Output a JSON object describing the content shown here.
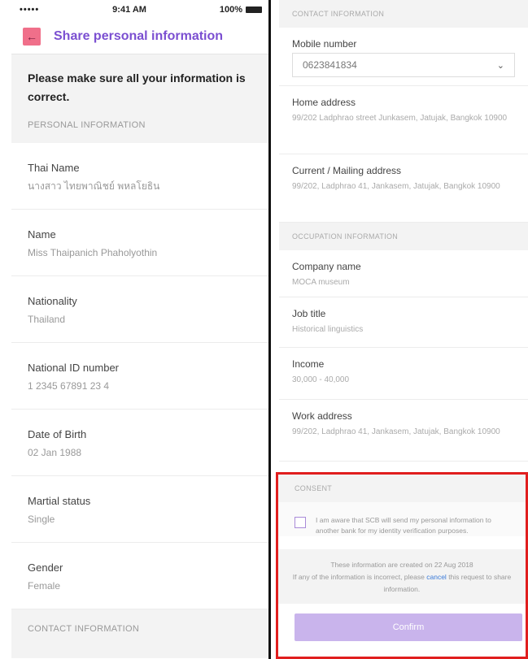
{
  "status_bar": {
    "signal": "•••••",
    "time": "9:41 AM",
    "battery": "100%"
  },
  "header": {
    "title": "Share personal information",
    "back_icon": "arrow-left-icon"
  },
  "notice": "Please make sure all your information is correct.",
  "personal_section": {
    "heading": "PERSONAL INFORMATION",
    "fields": [
      {
        "label": "Thai Name",
        "value": "นางสาว ไทยพาณิชย์ พหลโยธิน"
      },
      {
        "label": "Name",
        "value": "Miss Thaipanich Phaholyothin"
      },
      {
        "label": "Nationality",
        "value": "Thailand"
      },
      {
        "label": "National ID number",
        "value": "1 2345 67891 23 4"
      },
      {
        "label": "Date of Birth",
        "value": "02 Jan 1988"
      },
      {
        "label": "Martial status",
        "value": "Single"
      },
      {
        "label": "Gender",
        "value": "Female"
      }
    ]
  },
  "contact_section_left": {
    "heading": "CONTACT INFORMATION"
  },
  "contact_section": {
    "heading": "CONTACT INFORMATION",
    "mobile_label": "Mobile number",
    "mobile_value": "0623841834",
    "home_label": "Home address",
    "home_value": "99/202 Ladphrao street Junkasem, Jatujak, Bangkok 10900",
    "current_label": "Current / Mailing address",
    "current_value": "99/202, Ladphrao 41, Jankasem, Jatujak, Bangkok 10900"
  },
  "occupation_section": {
    "heading": "OCCUPATION INFORMATION",
    "fields": [
      {
        "label": "Company name",
        "value": "MOCA museum"
      },
      {
        "label": "Job title",
        "value": "Historical linguistics"
      },
      {
        "label": "Income",
        "value": "30,000 - 40,000"
      },
      {
        "label": "Work address",
        "value": "99/202, Ladphrao 41, Jankasem, Jatujak, Bangkok 10900"
      }
    ]
  },
  "consent": {
    "heading": "CONSENT",
    "text": "I am aware that SCB will send my personal information to another bank for my identity verification purposes.",
    "created_line": "These information are created on 22 Aug 2018",
    "incorrect_pre": "If any of the information is incorrect, please",
    "cancel_link": "cancel",
    "incorrect_post": "this request to share information.",
    "confirm_label": "Confirm"
  },
  "colors": {
    "accent": "#7b4fd1",
    "back_button": "#f06f8a",
    "confirm_disabled": "#c9b4ec",
    "highlight": "#e01e1e"
  }
}
